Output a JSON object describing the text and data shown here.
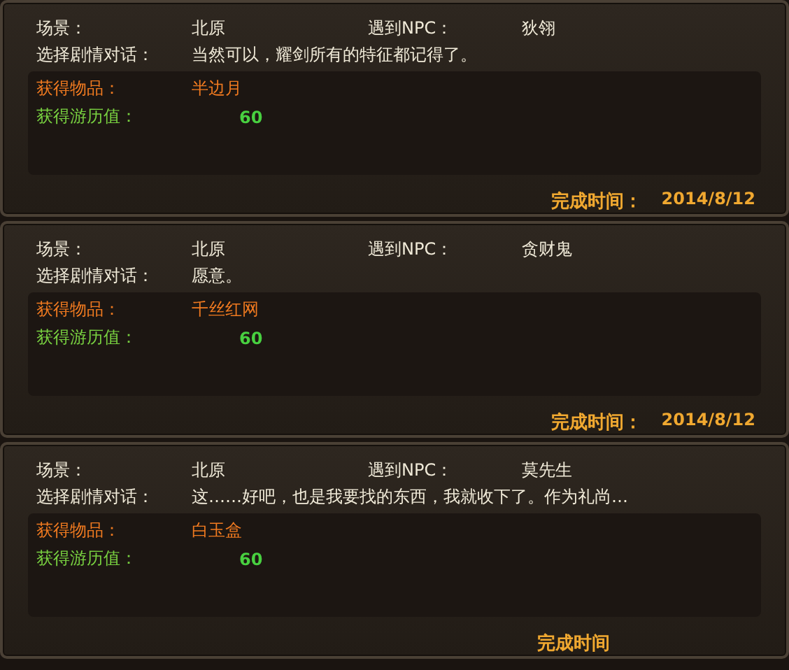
{
  "records": [
    {
      "scene_label": "场景：",
      "scene": "北原",
      "npc_label": "遇到NPC：",
      "npc": "狄翎",
      "dialog_label": "选择剧情对话：",
      "dialog": "当然可以，耀剑所有的特征都记得了。",
      "item_label": "获得物品：",
      "item": "半边月",
      "exp_label": "获得游历值：",
      "exp": "60",
      "time_label": "完成时间：",
      "time": "2014/8/12"
    },
    {
      "scene_label": "场景：",
      "scene": "北原",
      "npc_label": "遇到NPC：",
      "npc": "贪财鬼",
      "dialog_label": "选择剧情对话：",
      "dialog": "愿意。",
      "item_label": "获得物品：",
      "item": "千丝红网",
      "exp_label": "获得游历值：",
      "exp": "60",
      "time_label": "完成时间：",
      "time": "2014/8/12"
    },
    {
      "scene_label": "场景：",
      "scene": "北原",
      "npc_label": "遇到NPC：",
      "npc": "莫先生",
      "dialog_label": "选择剧情对话：",
      "dialog": "这……好吧，也是我要找的东西，我就收下了。作为礼尚…",
      "item_label": "获得物品：",
      "item": "白玉盒",
      "exp_label": "获得游历值：",
      "exp": "60",
      "time_label": "完成时间"
    }
  ]
}
